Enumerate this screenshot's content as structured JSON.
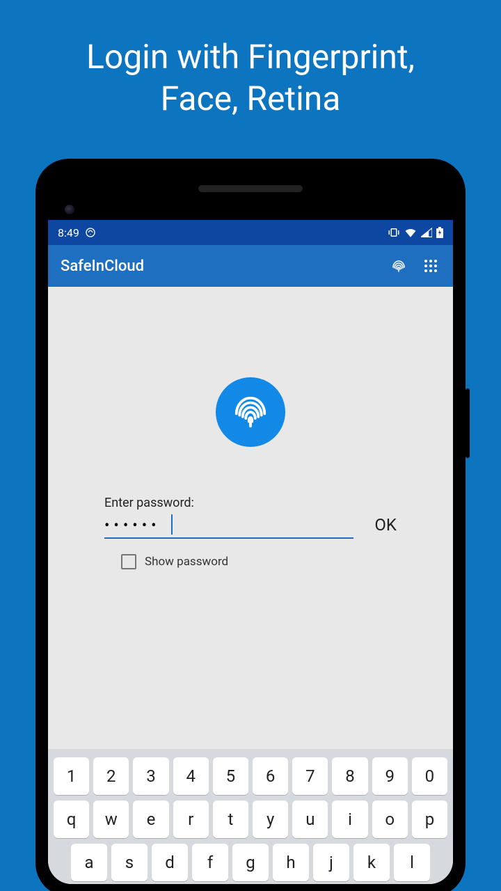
{
  "promo": {
    "title_line1": "Login with Fingerprint,",
    "title_line2": "Face, Retina"
  },
  "statusbar": {
    "time": "8:49"
  },
  "appbar": {
    "title": "SafeInCloud"
  },
  "login": {
    "label": "Enter password:",
    "password_masked": "••••••",
    "ok_label": "OK",
    "show_password_label": "Show password",
    "show_password_checked": false
  },
  "keyboard": {
    "row1": [
      "1",
      "2",
      "3",
      "4",
      "5",
      "6",
      "7",
      "8",
      "9",
      "0"
    ],
    "row2": [
      "q",
      "w",
      "e",
      "r",
      "t",
      "y",
      "u",
      "i",
      "o",
      "p"
    ],
    "row3": [
      "a",
      "s",
      "d",
      "f",
      "g",
      "h",
      "j",
      "k",
      "l"
    ]
  }
}
